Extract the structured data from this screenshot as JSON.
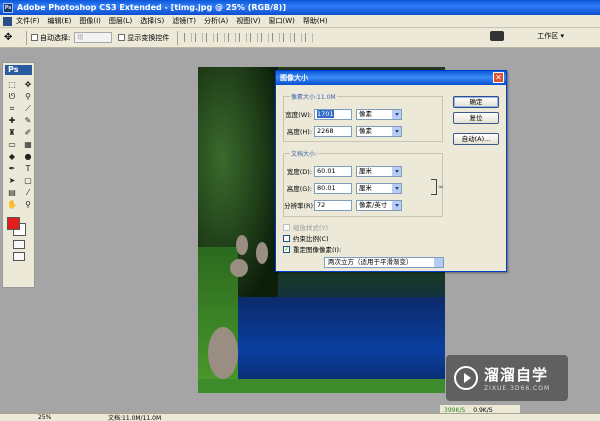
{
  "window": {
    "title": "Adobe Photoshop CS3 Extended - [timg.jpg @ 25% (RGB/8)]"
  },
  "menu": {
    "items": [
      "文件(F)",
      "编辑(E)",
      "图像(I)",
      "图层(L)",
      "选择(S)",
      "滤镜(T)",
      "分析(A)",
      "视图(V)",
      "窗口(W)",
      "帮助(H)"
    ]
  },
  "options": {
    "auto_select_label": "自动选择:",
    "auto_select_value": "组",
    "show_transform_label": "显示变换控件",
    "workspace_label": "工作区 ▾"
  },
  "toolbox": {
    "badge": "Ps",
    "foreground_color": "#e41e1e",
    "background_color": "#ffffff"
  },
  "dialog": {
    "title": "图像大小",
    "close_glyph": "✕",
    "pixel_dimensions": {
      "label": "像素大小:11.0M",
      "width_label": "宽度(W):",
      "width_value": "1701",
      "width_unit": "像素",
      "height_label": "高度(H):",
      "height_value": "2268",
      "height_unit": "像素"
    },
    "document_size": {
      "label": "文档大小:",
      "width_label": "宽度(D):",
      "width_value": "60.01",
      "width_unit": "厘米",
      "height_label": "高度(G):",
      "height_value": "80.01",
      "height_unit": "厘米",
      "resolution_label": "分辨率(R):",
      "resolution_value": "72",
      "resolution_unit": "像素/英寸"
    },
    "scale_styles_label": "缩放样式(Y)",
    "constrain_label": "约束比例(C)",
    "resample_label": "重定图像像素(I):",
    "resample_method": "两次立方（适用于平滑渐变）",
    "buttons": {
      "ok": "确定",
      "reset": "复位",
      "auto": "自动(A)..."
    }
  },
  "status": {
    "zoom": "25%",
    "doc_info": "文档:11.0M/11.0M",
    "net_down": "399K/S",
    "net_up": "0.9K/S"
  },
  "watermark": {
    "brand": "溜溜自学",
    "site": "ZIXUE.3D66.COM"
  }
}
